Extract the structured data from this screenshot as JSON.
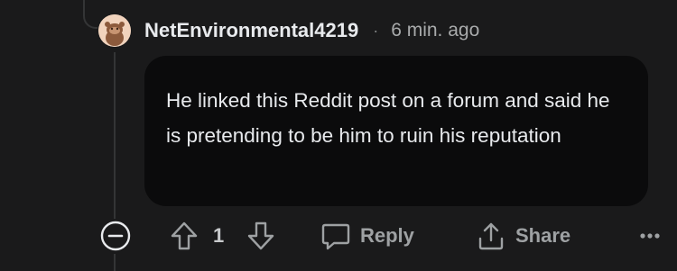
{
  "comment": {
    "username": "NetEnvironmental4219",
    "separator": "·",
    "timestamp": "6 min. ago",
    "body": "He linked this Reddit post on a forum and said he is pretending to be him to ruin his reputation",
    "vote_count": "1"
  },
  "actions": {
    "reply_label": "Reply",
    "share_label": "Share"
  },
  "icons": {
    "avatar": "snoo-avatar",
    "collapse": "collapse-minus-icon",
    "upvote": "upvote-arrow-icon",
    "downvote": "downvote-arrow-icon",
    "reply": "speech-bubble-icon",
    "share": "share-upload-icon",
    "more": "more-dots-icon"
  },
  "colors": {
    "background": "#1a1a1b",
    "bubble": "#0b0b0c",
    "thread_line": "#343536",
    "muted_text": "#9ea1a3"
  }
}
